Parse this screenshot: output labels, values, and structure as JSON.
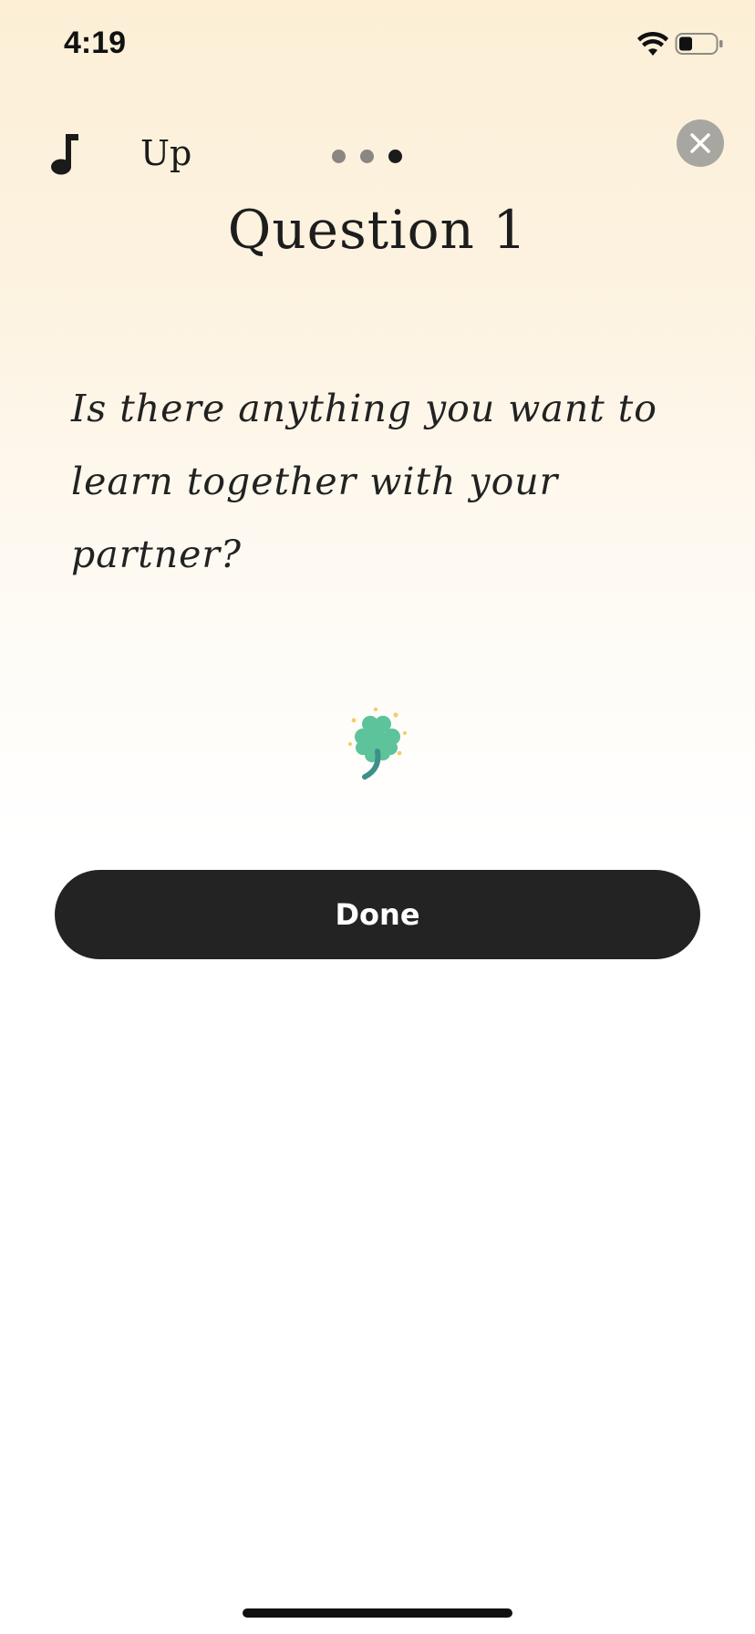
{
  "status_bar": {
    "time": "4:19",
    "icons": [
      "wifi-icon",
      "battery-icon"
    ]
  },
  "header": {
    "music_icon": "music-note-icon",
    "track_name": "Up",
    "page_dots": {
      "count": 3,
      "active_index": 2
    },
    "close_icon": "close-icon"
  },
  "question": {
    "title": "Question 1",
    "text": "Is there anything you want to learn together with your partner?"
  },
  "decoration": {
    "icon": "four-leaf-clover-icon"
  },
  "actions": {
    "done_label": "Done"
  },
  "colors": {
    "background_top": "#fcefd6",
    "button": "#232323",
    "close_button": "#a8a6a1",
    "clover": "#5cc39a"
  }
}
